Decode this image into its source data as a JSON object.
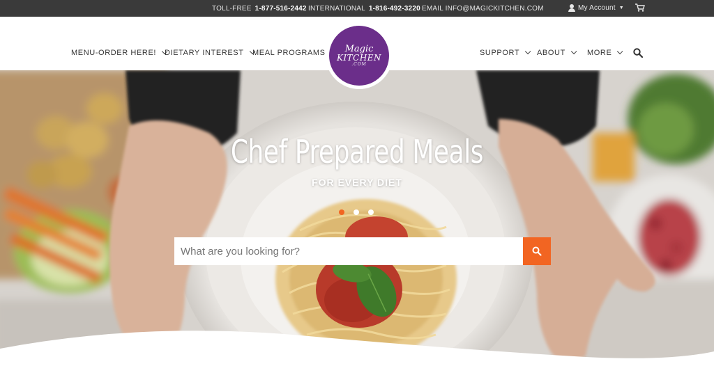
{
  "topbar": {
    "tollfree_label": "TOLL-FREE",
    "tollfree_number": "1-877-516-2442",
    "international_label": "INTERNATIONAL",
    "international_number": "1-816-492-3220",
    "email": "EMAIL INFO@MAGICKITCHEN.COM",
    "account_label": "My Account",
    "icons": [
      "user-icon",
      "caret-down-icon",
      "cart-icon"
    ]
  },
  "nav": {
    "left": [
      {
        "label": "MENU-ORDER HERE!",
        "has_dropdown": true
      },
      {
        "label": "DIETARY INTEREST",
        "has_dropdown": true
      },
      {
        "label": "MEAL PROGRAMS",
        "has_dropdown": false
      }
    ],
    "right": [
      {
        "label": "SUPPORT",
        "has_dropdown": true
      },
      {
        "label": "ABOUT",
        "has_dropdown": true
      },
      {
        "label": "MORE",
        "has_dropdown": true
      }
    ],
    "search_icon": "search-icon"
  },
  "logo": {
    "line1": "Magic",
    "line2": "KITCHEN",
    "line3": ".COM",
    "color": "#6b2e8a"
  },
  "hero": {
    "title": "Chef Prepared Meals",
    "subtitle": "FOR EVERY DIET",
    "slides": 3,
    "active_slide": 1,
    "search_placeholder": "What are you looking for?",
    "accent_color": "#f26522"
  }
}
